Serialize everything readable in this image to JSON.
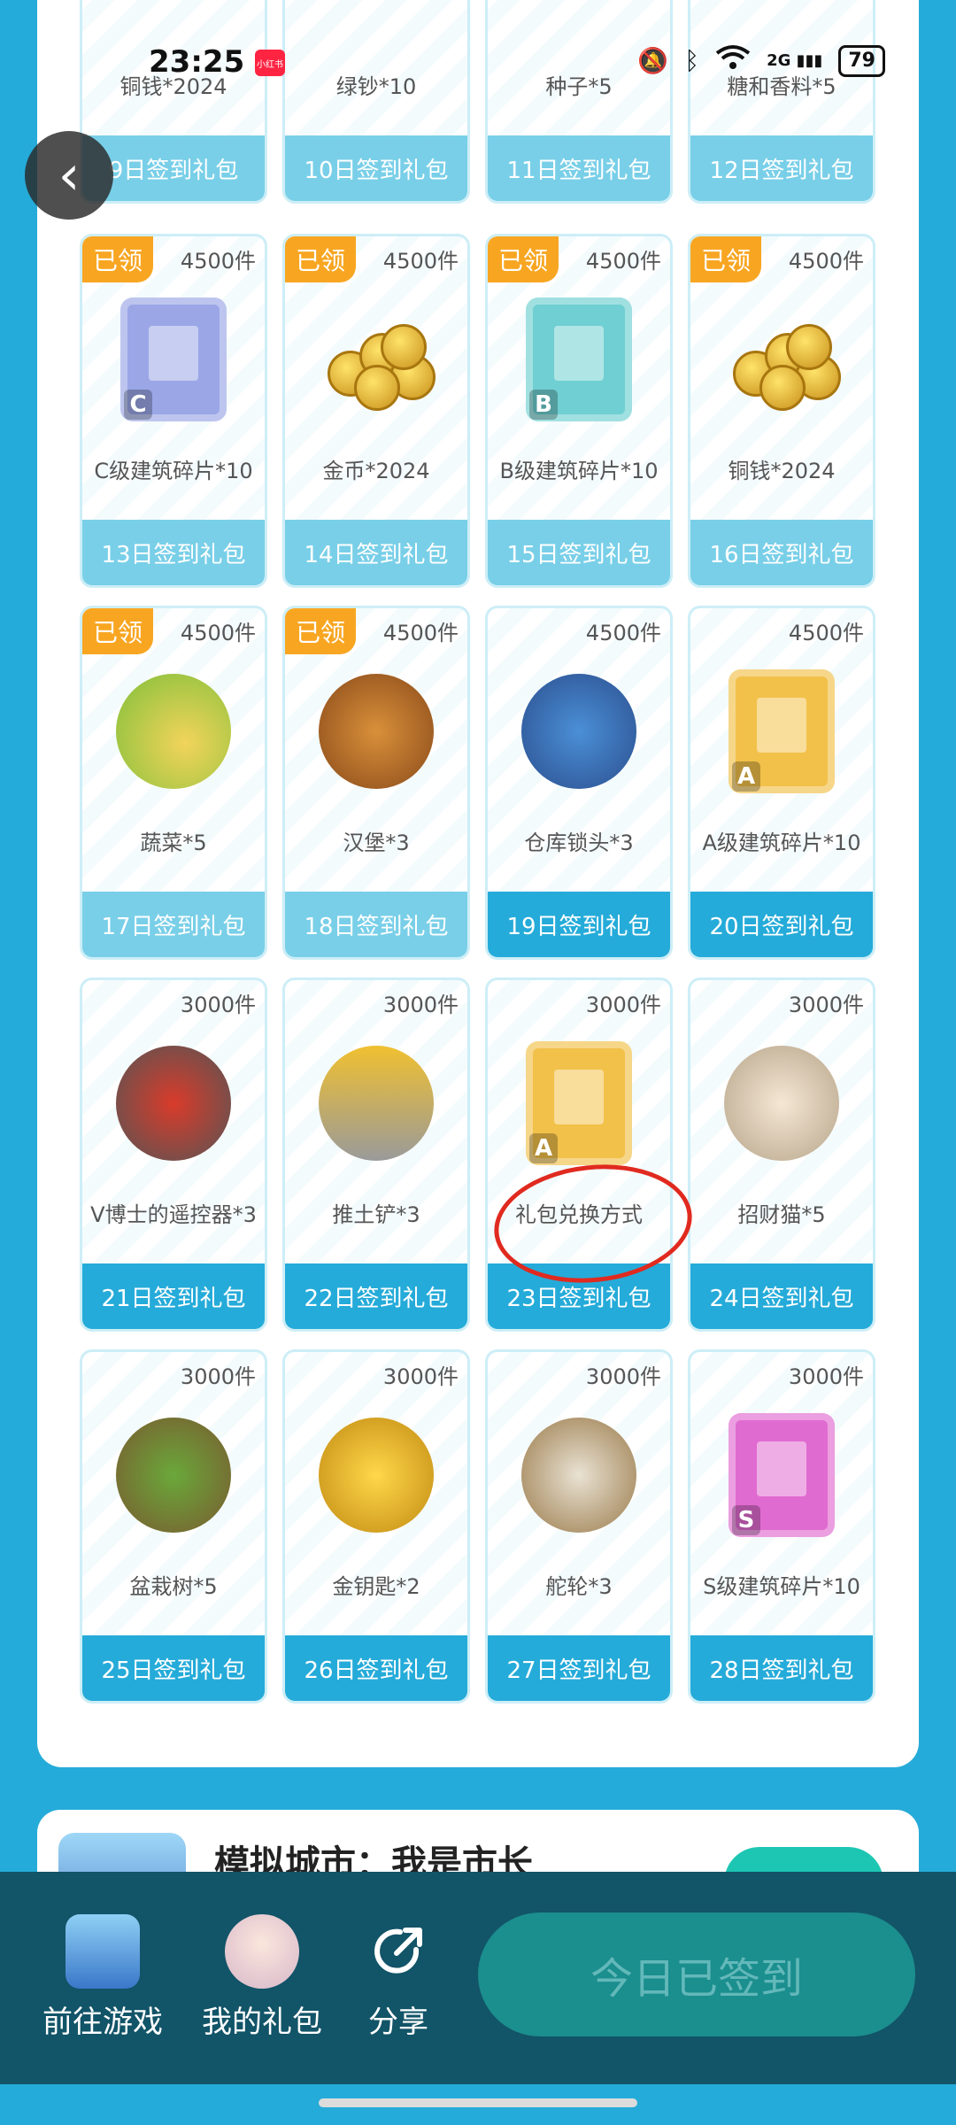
{
  "status_bar": {
    "time": "23:25",
    "app_badge": "小红书",
    "signal_label": "2G",
    "battery": "79"
  },
  "cards_row0": [
    {
      "name": "铜钱*2024",
      "footer": "9日签到礼包"
    },
    {
      "name": "绿钞*10",
      "footer": "10日签到礼包"
    },
    {
      "name": "种子*5",
      "footer": "11日签到礼包"
    },
    {
      "name": "糖和香料*5",
      "footer": "12日签到礼包"
    }
  ],
  "cards": [
    {
      "tag": "已领",
      "stock": "4500件",
      "name": "C级建筑碎片*10",
      "footer": "13日签到礼包",
      "icon": "c-shard-icon",
      "color": "#9aa6e6",
      "letter": "C"
    },
    {
      "tag": "已领",
      "stock": "4500件",
      "name": "金币*2024",
      "footer": "14日签到礼包",
      "icon": "gold-coins-icon"
    },
    {
      "tag": "已领",
      "stock": "4500件",
      "name": "B级建筑碎片*10",
      "footer": "15日签到礼包",
      "icon": "b-shard-icon",
      "color": "#6fcfd2",
      "letter": "B"
    },
    {
      "tag": "已领",
      "stock": "4500件",
      "name": "铜钱*2024",
      "footer": "16日签到礼包",
      "icon": "copper-coins-icon"
    },
    {
      "tag": "已领",
      "stock": "4500件",
      "name": "蔬菜*5",
      "footer": "17日签到礼包",
      "icon": "vegetables-icon"
    },
    {
      "tag": "已领",
      "stock": "4500件",
      "name": "汉堡*3",
      "footer": "18日签到礼包",
      "icon": "burger-icon"
    },
    {
      "tag": "",
      "stock": "4500件",
      "name": "仓库锁头*3",
      "footer": "19日签到礼包",
      "icon": "padlock-icon"
    },
    {
      "tag": "",
      "stock": "4500件",
      "name": "A级建筑碎片*10",
      "footer": "20日签到礼包",
      "icon": "a-shard-icon",
      "color": "#f2c14a",
      "letter": "A"
    },
    {
      "tag": "",
      "stock": "3000件",
      "name": "V博士的遥控器*3",
      "footer": "21日签到礼包",
      "icon": "remote-switch-icon"
    },
    {
      "tag": "",
      "stock": "3000件",
      "name": "推土铲*3",
      "footer": "22日签到礼包",
      "icon": "bulldozer-blade-icon"
    },
    {
      "tag": "",
      "stock": "3000件",
      "name": "礼包兑换方式",
      "footer": "23日签到礼包",
      "icon": "a-shard-icon",
      "color": "#f2c14a",
      "letter": "A"
    },
    {
      "tag": "",
      "stock": "3000件",
      "name": "招财猫*5",
      "footer": "24日签到礼包",
      "icon": "lucky-cat-icon"
    },
    {
      "tag": "",
      "stock": "3000件",
      "name": "盆栽树*5",
      "footer": "25日签到礼包",
      "icon": "bonsai-icon"
    },
    {
      "tag": "",
      "stock": "3000件",
      "name": "金钥匙*2",
      "footer": "26日签到礼包",
      "icon": "gold-key-icon"
    },
    {
      "tag": "",
      "stock": "3000件",
      "name": "舵轮*3",
      "footer": "27日签到礼包",
      "icon": "ship-wheel-icon"
    },
    {
      "tag": "",
      "stock": "3000件",
      "name": "S级建筑碎片*10",
      "footer": "28日签到礼包",
      "icon": "s-shard-icon",
      "color": "#e06bd0",
      "letter": "S"
    }
  ],
  "game_strip": {
    "title": "模拟城市：我是市长"
  },
  "bottom_bar": {
    "go_game": "前往游戏",
    "my_gifts": "我的礼包",
    "share": "分享",
    "signed_button": "今日已签到"
  },
  "colors": {
    "accent_blue": "#25abd9",
    "claimed_tag": "#f8a622",
    "bottom_bar": "#125468",
    "annotation_red": "#e02a1f"
  }
}
